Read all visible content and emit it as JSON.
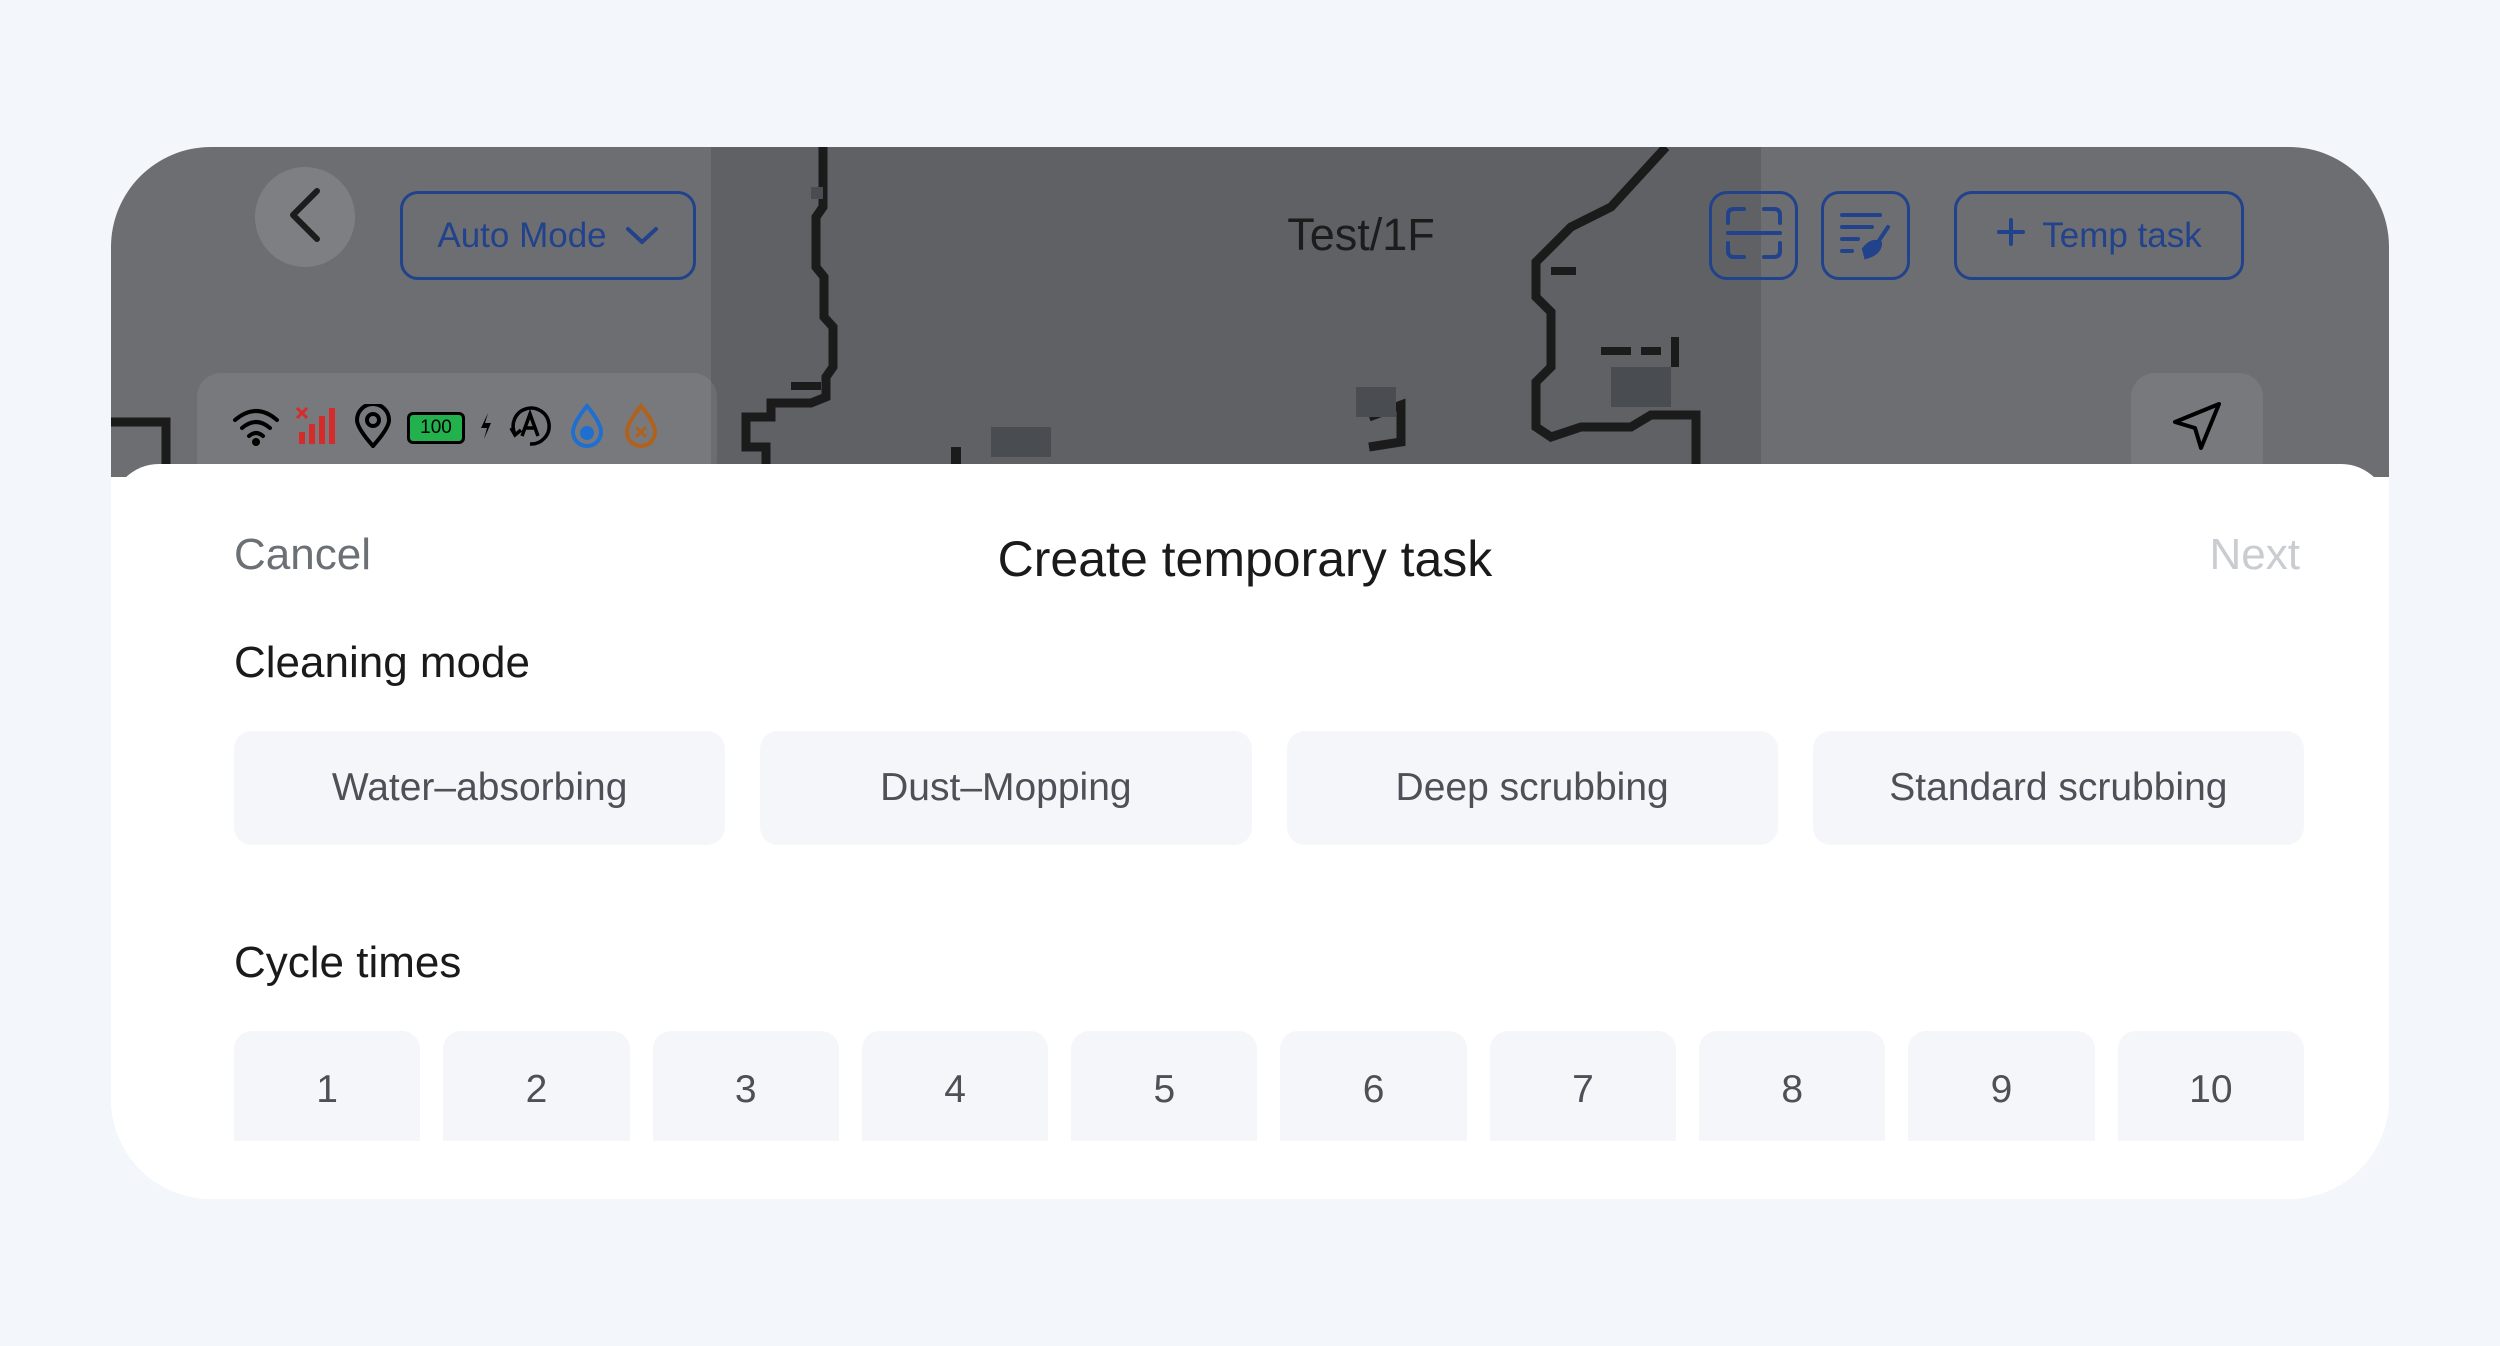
{
  "header": {
    "mode_label": "Auto Mode",
    "map_title": "Test/1F",
    "temp_task_label": "Temp task",
    "battery_level": "100"
  },
  "sheet": {
    "cancel_label": "Cancel",
    "title": "Create temporary task",
    "next_label": "Next",
    "cleaning_mode_label": "Cleaning mode",
    "cleaning_modes": [
      "Water–absorbing",
      "Dust–Mopping",
      "Deep scrubbing",
      "Standard scrubbing"
    ],
    "cycle_times_label": "Cycle times",
    "cycle_options": [
      "1",
      "2",
      "3",
      "4",
      "5",
      "6",
      "7",
      "8",
      "9",
      "10"
    ]
  },
  "colors": {
    "accent": "#22428c",
    "chip_background": "#f4f6fa",
    "disabled_text": "#c9ccd1"
  }
}
